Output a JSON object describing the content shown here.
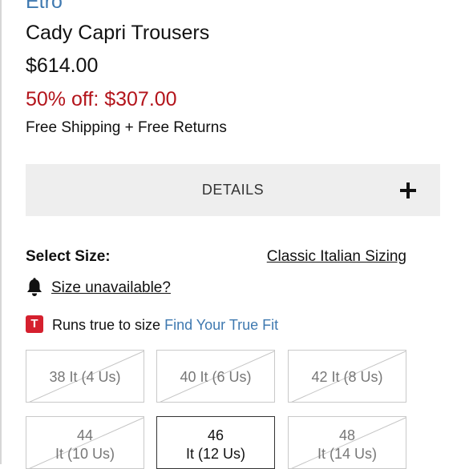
{
  "product": {
    "brand": "Etro",
    "title": "Cady Capri Trousers",
    "price": "$614.00",
    "sale_price": "50% off: $307.00",
    "shipping": "Free Shipping + Free Returns"
  },
  "details": {
    "label": "DETAILS",
    "icon": "plus-icon"
  },
  "size_selector": {
    "heading": "Select Size:",
    "sizing_link": "Classic Italian Sizing",
    "unavailable_link": "Size unavailable?",
    "fit_badge": "T",
    "fit_text": "Runs true to size",
    "fit_link": "Find Your True Fit",
    "sizes": [
      {
        "line1": "38 It (4 Us)",
        "available": false
      },
      {
        "line1": "40 It (6 Us)",
        "available": false
      },
      {
        "line1": "42 It (8 Us)",
        "available": false
      },
      {
        "line1": "44",
        "line2": "It (10 Us)",
        "available": false
      },
      {
        "line1": "46",
        "line2": "It (12 Us)",
        "available": true
      },
      {
        "line1": "48",
        "line2": "It (14 Us)",
        "available": false
      }
    ]
  },
  "colors": {
    "brand_blue": "#3f79b0",
    "sale_red": "#b3141b",
    "badge_red": "#d5202e",
    "details_bg": "#eeeeee"
  }
}
